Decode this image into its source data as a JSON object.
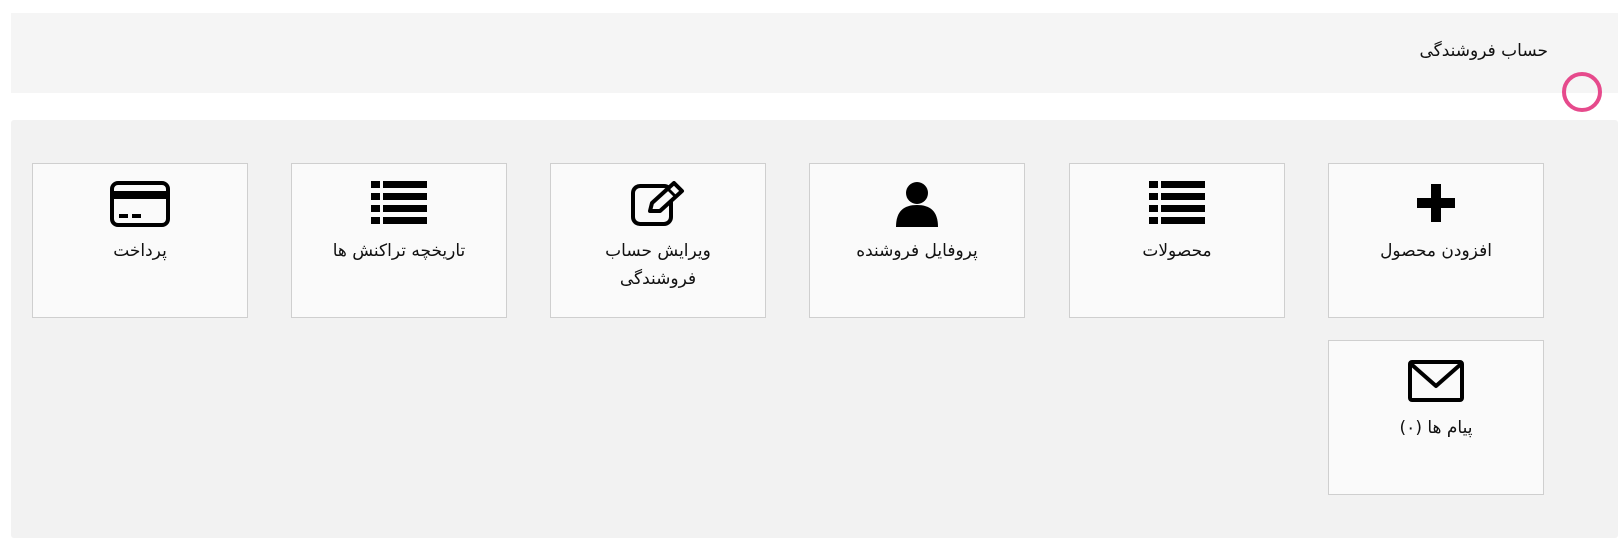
{
  "header": {
    "title": "حساب فروشندگی"
  },
  "dashboard": {
    "tiles": [
      {
        "label": "افزودن محصول",
        "icon": "plus-icon"
      },
      {
        "label": "محصولات",
        "icon": "list-icon"
      },
      {
        "label": "پروفایل فروشنده",
        "icon": "user-icon"
      },
      {
        "label": "ویرایش حساب فروشندگی",
        "icon": "edit-icon"
      },
      {
        "label": "تاریخچه تراکنش ها",
        "icon": "list-icon"
      },
      {
        "label": "پرداخت",
        "icon": "credit-card-icon"
      },
      {
        "label": "پیام ها (۰)",
        "icon": "envelope-icon"
      }
    ]
  },
  "colors": {
    "header_bg": "#f5f5f5",
    "panel_bg": "#f2f2f2",
    "tile_bg": "#fafafa",
    "tile_border": "#cfcfcf",
    "accent_pink": "#e64a8c"
  }
}
